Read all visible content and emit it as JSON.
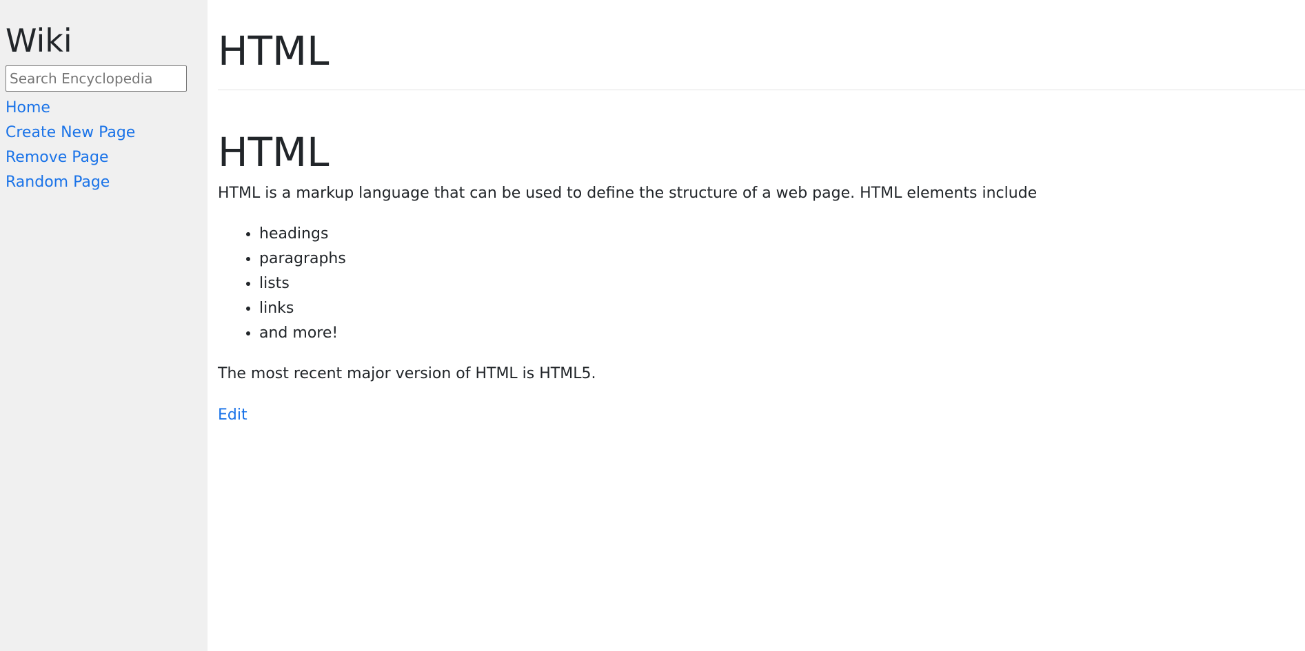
{
  "sidebar": {
    "brand": "Wiki",
    "search": {
      "placeholder": "Search Encyclopedia",
      "value": ""
    },
    "links": [
      {
        "label": "Home"
      },
      {
        "label": "Create New Page"
      },
      {
        "label": "Remove Page"
      },
      {
        "label": "Random Page"
      }
    ]
  },
  "main": {
    "page_title": "HTML",
    "article": {
      "heading": "HTML",
      "intro": "HTML is a markup language that can be used to define the structure of a web page. HTML elements include",
      "items": [
        "headings",
        "paragraphs",
        "lists",
        "links",
        "and more!"
      ],
      "closing": "The most recent major version of HTML is HTML5."
    },
    "edit_label": "Edit"
  },
  "colors": {
    "sidebar_bg": "#f0f0f0",
    "link": "#1a73e8",
    "text": "#212529"
  }
}
